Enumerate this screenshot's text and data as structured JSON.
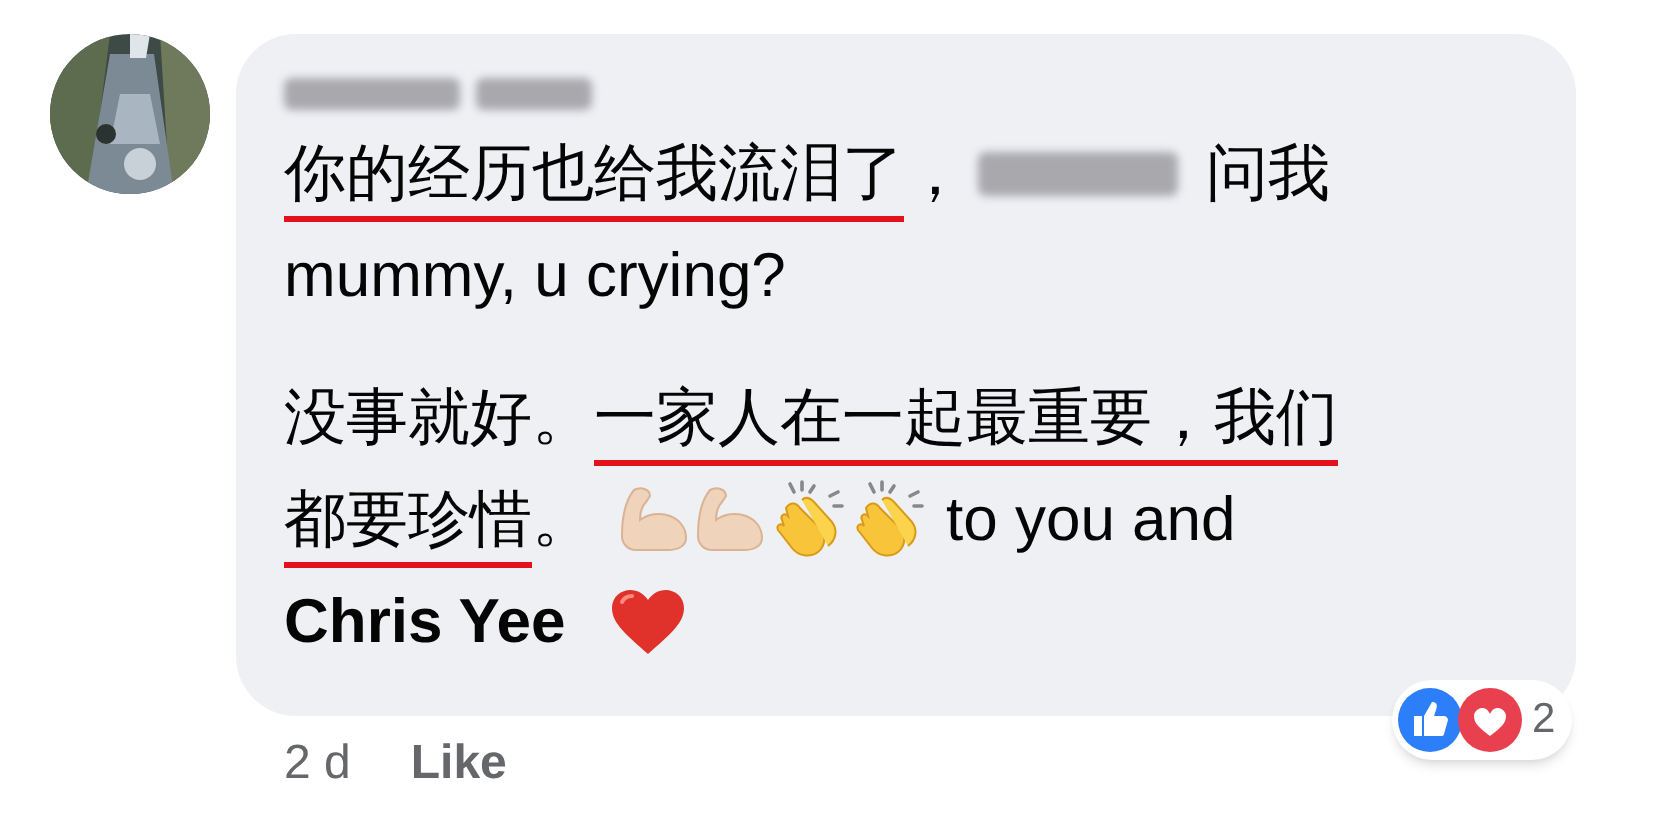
{
  "author": {
    "kind": "redacted"
  },
  "paragraphs": [
    [
      [
        {
          "kind": "text",
          "text": "你的经历也给我流泪了",
          "underlined": true
        },
        {
          "kind": "text",
          "text": "，",
          "underlined": false
        },
        {
          "kind": "redacted"
        },
        {
          "kind": "text",
          "text": "问我",
          "underlined": false
        }
      ],
      [
        {
          "kind": "text",
          "text": "mummy, u crying?",
          "underlined": false
        }
      ]
    ],
    [
      [
        {
          "kind": "text",
          "text": "没事就好。",
          "underlined": false
        },
        {
          "kind": "text",
          "text": "一家人在一起最重要，我们",
          "underlined": true
        }
      ],
      [
        {
          "kind": "text",
          "text": "都要珍惜",
          "underlined": true
        },
        {
          "kind": "text",
          "text": "。",
          "underlined": false
        },
        {
          "kind": "arm"
        },
        {
          "kind": "arm"
        },
        {
          "kind": "clap"
        },
        {
          "kind": "clap"
        },
        {
          "kind": "text",
          "text": "to you and",
          "underlined": false
        }
      ],
      [
        {
          "kind": "text",
          "text": "Chris Yee",
          "underlined": false,
          "bold": true
        },
        {
          "kind": "heart"
        }
      ]
    ]
  ],
  "time": "2 d",
  "like_label": "Like",
  "reactions": {
    "icons": [
      {
        "kind": "like"
      },
      {
        "kind": "love"
      }
    ],
    "count": "2"
  }
}
